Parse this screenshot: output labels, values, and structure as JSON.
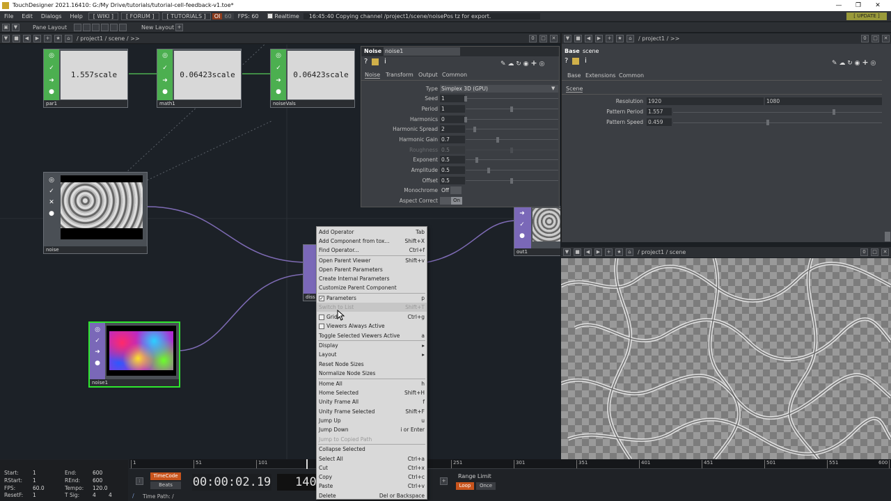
{
  "window": {
    "title": "TouchDesigner 2021.16410: G:/My Drive/tutorials/tutorial-cell-feedback-v1.toe*"
  },
  "menubar": {
    "file": "File",
    "edit": "Edit",
    "dialogs": "Dialogs",
    "help": "Help",
    "wiki": "[ WIKI ]",
    "forum": "[ FORUM ]",
    "tutorials": "[ TUTORIALS ]",
    "oi": "OI",
    "fps_cap": "60",
    "fps": "FPS:  60",
    "realtime": "Realtime",
    "status": "16:45:40 Copying channel /project1/scene/noisePos tz for export.",
    "update": "[ UPDATE ]"
  },
  "panebar": {
    "pane_layout": "Pane Layout",
    "new_layout": "New Layout",
    "add": "+"
  },
  "network_path": {
    "path": "/  project1  /  scene  /  >>",
    "zero": "0"
  },
  "nodes": {
    "par1": {
      "name": "par1",
      "value": "1.557scale"
    },
    "math1": {
      "name": "math1",
      "value": "0.06423scale"
    },
    "noiseVals": {
      "name": "noiseVals",
      "value": "0.06423scale"
    },
    "noise": {
      "name": "noise"
    },
    "noise1": {
      "name": "noise1"
    },
    "out1": {
      "name": "out1"
    },
    "diss": {
      "name": "diss"
    }
  },
  "noise_params": {
    "type_label": "Noise",
    "name": "noise1",
    "tabs": [
      "Noise",
      "Transform",
      "Output",
      "Common"
    ],
    "rows": [
      {
        "label": "Type",
        "value": "Simplex 3D (GPU)"
      },
      {
        "label": "Seed",
        "value": "1"
      },
      {
        "label": "Period",
        "value": "1"
      },
      {
        "label": "Harmonics",
        "value": "0"
      },
      {
        "label": "Harmonic Spread",
        "value": "2"
      },
      {
        "label": "Harmonic Gain",
        "value": "0.7"
      },
      {
        "label": "Roughness",
        "value": "0.5"
      },
      {
        "label": "Exponent",
        "value": "0.5"
      },
      {
        "label": "Amplitude",
        "value": "0.5"
      },
      {
        "label": "Offset",
        "value": "0.5"
      },
      {
        "label": "Monochrome",
        "value": "Off"
      },
      {
        "label": "Aspect Correct",
        "value": "On"
      }
    ]
  },
  "right_panel": {
    "path": "/  project1  /  >>",
    "zero": "0",
    "type_label": "Base",
    "name": "scene",
    "tabs": [
      "Base",
      "Extensions",
      "Common"
    ],
    "page": "Scene",
    "resolution_label": "Resolution",
    "res_w": "1920",
    "res_h": "1080",
    "pattern_period_label": "Pattern Period",
    "pattern_period": "1.557",
    "pattern_speed_label": "Pattern Speed",
    "pattern_speed": "0.459"
  },
  "viewer_path": {
    "path": "/  project1  /  scene",
    "zero": "0"
  },
  "context_menu": {
    "items": [
      {
        "label": "Add Operator",
        "shortcut": "Tab"
      },
      {
        "label": "Add Component from tox...",
        "shortcut": "Shift+X"
      },
      {
        "label": "Find Operator...",
        "shortcut": "Ctrl+f"
      },
      {
        "label": "Open Parent Viewer",
        "shortcut": "Shift+v"
      },
      {
        "label": "Open Parent Parameters",
        "shortcut": ""
      },
      {
        "label": "Create Internal Parameters",
        "shortcut": ""
      },
      {
        "label": "Customize Parent Component",
        "shortcut": ""
      },
      {
        "label": "Parameters",
        "shortcut": "p"
      },
      {
        "label": "Switch to List",
        "shortcut": "Shift+T"
      },
      {
        "label": "Grid",
        "shortcut": "Ctrl+g"
      },
      {
        "label": "Viewers Always Active",
        "shortcut": ""
      },
      {
        "label": "Toggle Selected Viewers Active",
        "shortcut": "a"
      },
      {
        "label": "Display",
        "shortcut": "▸"
      },
      {
        "label": "Layout",
        "shortcut": "▸"
      },
      {
        "label": "Reset Node Sizes",
        "shortcut": ""
      },
      {
        "label": "Normalize Node Sizes",
        "shortcut": ""
      },
      {
        "label": "Home All",
        "shortcut": "h"
      },
      {
        "label": "Home Selected",
        "shortcut": "Shift+H"
      },
      {
        "label": "Unity Frame All",
        "shortcut": "f"
      },
      {
        "label": "Unity Frame Selected",
        "shortcut": "Shift+F"
      },
      {
        "label": "Jump Up",
        "shortcut": "u"
      },
      {
        "label": "Jump Down",
        "shortcut": "i or Enter"
      },
      {
        "label": "Jump to Copied Path",
        "shortcut": ""
      },
      {
        "label": "Collapse Selected",
        "shortcut": ""
      },
      {
        "label": "Select All",
        "shortcut": "Ctrl+a"
      },
      {
        "label": "Cut",
        "shortcut": "Ctrl+x"
      },
      {
        "label": "Copy",
        "shortcut": "Ctrl+c"
      },
      {
        "label": "Paste",
        "shortcut": "Ctrl+v"
      },
      {
        "label": "Delete",
        "shortcut": "Del or Backspace"
      }
    ]
  },
  "stats": {
    "start_l": "Start:",
    "start": "1",
    "end_l": "End:",
    "end": "600",
    "rstart_l": "RStart:",
    "rstart": "1",
    "rend_l": "REnd:",
    "rend": "600",
    "fps_l": "FPS:",
    "fps": "60.0",
    "tempo_l": "Tempo:",
    "tempo": "120.0",
    "resetf_l": "ResetF:",
    "resetf": "1",
    "tsig_l": "T Sig:",
    "tsig_a": "4",
    "tsig_b": "4"
  },
  "timeline": {
    "ticks": [
      "1",
      "51",
      "101",
      "251",
      "301",
      "351",
      "401",
      "451",
      "501",
      "551",
      "600"
    ],
    "timecode_label": "TimeCode",
    "beats_label": "Beats",
    "timecode": "00:00:02.19",
    "frame": "140",
    "range_limit": "Range Limit",
    "loop": "Loop",
    "once": "Once",
    "time_path": "Time Path: /"
  },
  "colors": {
    "chop": "#4caf50",
    "top": "#7a68b8",
    "selected": "#2ee82e",
    "wire": "#7e6bb5"
  }
}
